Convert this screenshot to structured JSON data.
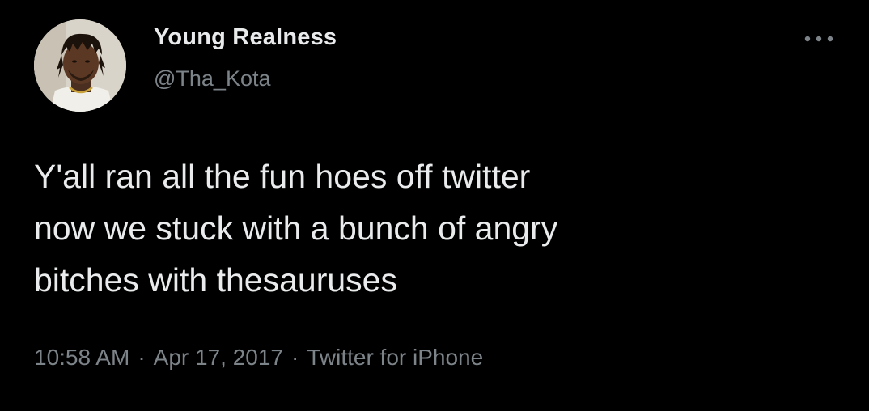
{
  "author": {
    "name": "Young Realness",
    "handle": "@Tha_Kota"
  },
  "tweet": {
    "lines": [
      "Y'all ran all the fun hoes off twitter",
      "now we stuck with a bunch of angry",
      "bitches with thesauruses"
    ],
    "time": "10:58 AM",
    "date": "Apr 17, 2017",
    "separator": "·",
    "source": "Twitter for iPhone"
  },
  "icons": {
    "more": "more-horizontal-icon",
    "avatar": "profile-photo"
  },
  "colors": {
    "background": "#000000",
    "primary_text": "#e9ebec",
    "secondary_text": "#7d8489"
  }
}
